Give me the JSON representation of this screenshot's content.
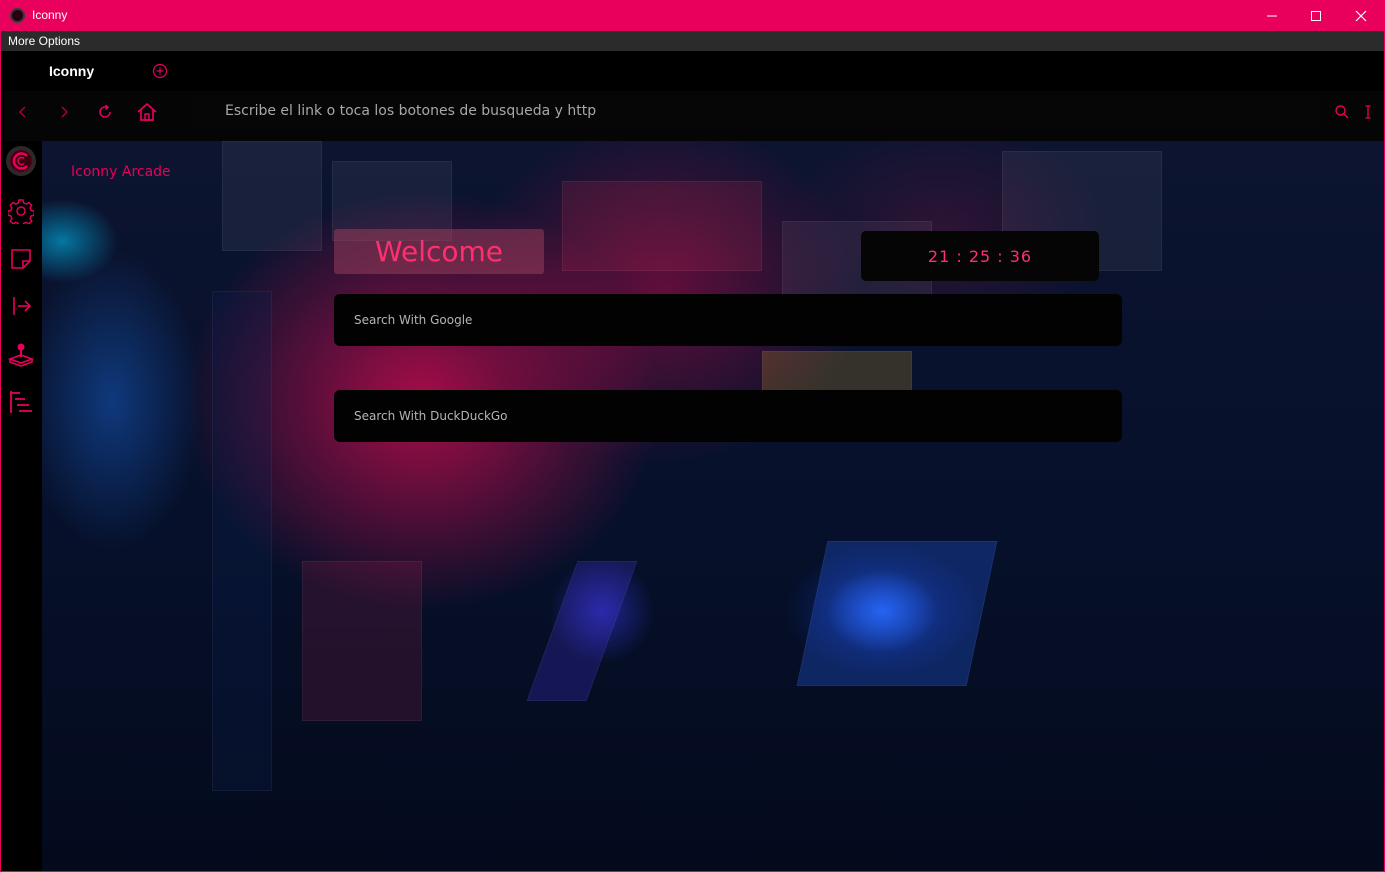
{
  "window": {
    "title": "Iconny",
    "accent_color": "#e8005c",
    "controls": [
      "minimize-icon",
      "maximize-icon",
      "close-icon"
    ]
  },
  "menubar": {
    "more_options_label": "More Options"
  },
  "tabs": [
    {
      "label": "Iconny",
      "active": true
    }
  ],
  "navbar": {
    "buttons": [
      "back-icon",
      "forward-icon",
      "refresh-icon",
      "home-icon"
    ],
    "address_placeholder": "Escribe el link o toca los botones de busqueda y http",
    "right_icons": [
      "search-icon",
      "text-cursor-icon"
    ]
  },
  "sidebar": {
    "items": [
      "logo-icon",
      "settings-icon",
      "note-icon",
      "exit-icon",
      "joystick-icon",
      "list-icon"
    ]
  },
  "page": {
    "arcade_title": "Iconny Arcade",
    "welcome": "Welcome",
    "clock": "21 : 25 : 36",
    "google_placeholder": "Search With Google",
    "duckduckgo_placeholder": "Search With DuckDuckGo"
  }
}
